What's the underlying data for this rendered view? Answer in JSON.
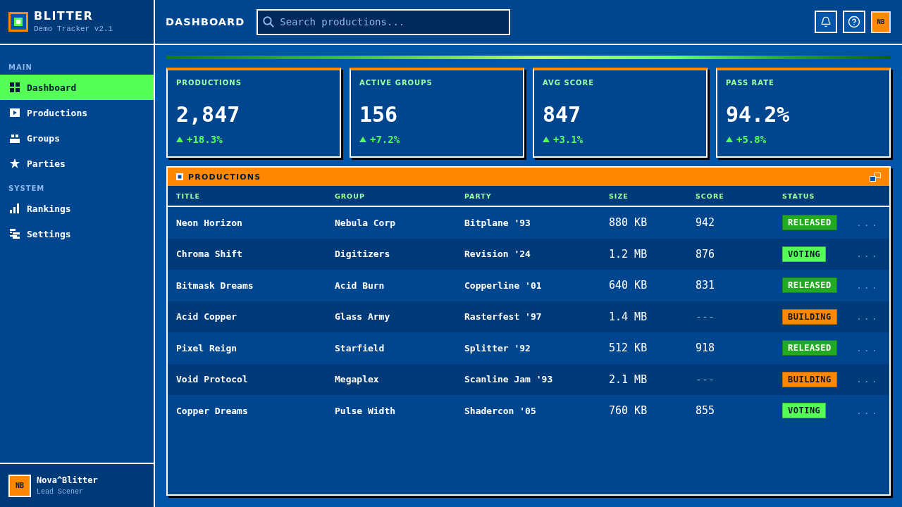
{
  "brand": {
    "name": "BLITTER",
    "subtitle": "Demo Tracker v2.1"
  },
  "sidebar": {
    "sections": [
      {
        "label": "MAIN",
        "items": [
          {
            "label": "Dashboard",
            "selected": true
          },
          {
            "label": "Productions",
            "selected": false
          },
          {
            "label": "Groups",
            "selected": false
          },
          {
            "label": "Parties",
            "selected": false
          }
        ]
      },
      {
        "label": "SYSTEM",
        "items": [
          {
            "label": "Rankings",
            "selected": false
          },
          {
            "label": "Settings",
            "selected": false
          }
        ]
      }
    ],
    "user": {
      "initials": "NB",
      "name": "Nova^Blitter",
      "role": "Lead Scener"
    }
  },
  "header": {
    "title": "DASHBOARD",
    "search": {
      "placeholder": "Search productions..."
    },
    "avatar": "NB"
  },
  "stats": [
    {
      "label": "PRODUCTIONS",
      "value": "2,847",
      "change": "+18.3%"
    },
    {
      "label": "ACTIVE GROUPS",
      "value": "156",
      "change": "+7.2%"
    },
    {
      "label": "AVG SCORE",
      "value": "847",
      "change": "+3.1%"
    },
    {
      "label": "PASS RATE",
      "value": "94.2%",
      "change": "+5.8%"
    }
  ],
  "table": {
    "title": "PRODUCTIONS",
    "columns": [
      "TITLE",
      "GROUP",
      "PARTY",
      "SIZE",
      "SCORE",
      "STATUS"
    ],
    "rows": [
      {
        "title": "Neon Horizon",
        "group": "Nebula Corp",
        "party": "Bitplane '93",
        "size": "880 KB",
        "score": "942",
        "scored": true,
        "status": {
          "label": "RELEASED",
          "color": "#22aa22"
        },
        "actions": "..."
      },
      {
        "title": "Chroma Shift",
        "group": "Digitizers",
        "party": "Revision '24",
        "size": "1.2 MB",
        "score": "876",
        "scored": true,
        "status": {
          "label": "VOTING",
          "color": "#55ff55"
        },
        "actions": "..."
      },
      {
        "title": "Bitmask Dreams",
        "group": "Acid Burn",
        "party": "Copperline '01",
        "size": "640 KB",
        "score": "831",
        "scored": true,
        "status": {
          "label": "RELEASED",
          "color": "#22aa22"
        },
        "actions": "..."
      },
      {
        "title": "Acid Copper",
        "group": "Glass Army",
        "party": "Rasterfest '97",
        "size": "1.4 MB",
        "score": "---",
        "scored": false,
        "status": {
          "label": "BUILDING",
          "color": "#ff8800"
        },
        "actions": "..."
      },
      {
        "title": "Pixel Reign",
        "group": "Starfield",
        "party": "Splitter '92",
        "size": "512 KB",
        "score": "918",
        "scored": true,
        "status": {
          "label": "RELEASED",
          "color": "#22aa22"
        },
        "actions": "..."
      },
      {
        "title": "Void Protocol",
        "group": "Megaplex",
        "party": "Scanline Jam '93",
        "size": "2.1 MB",
        "score": "---",
        "scored": false,
        "status": {
          "label": "BUILDING",
          "color": "#ff8800"
        },
        "actions": "..."
      },
      {
        "title": "Copper Dreams",
        "group": "Pulse Width",
        "party": "Shadercon '05",
        "size": "760 KB",
        "score": "855",
        "scored": true,
        "status": {
          "label": "VOTING",
          "color": "#55ff55"
        },
        "actions": "..."
      }
    ]
  }
}
